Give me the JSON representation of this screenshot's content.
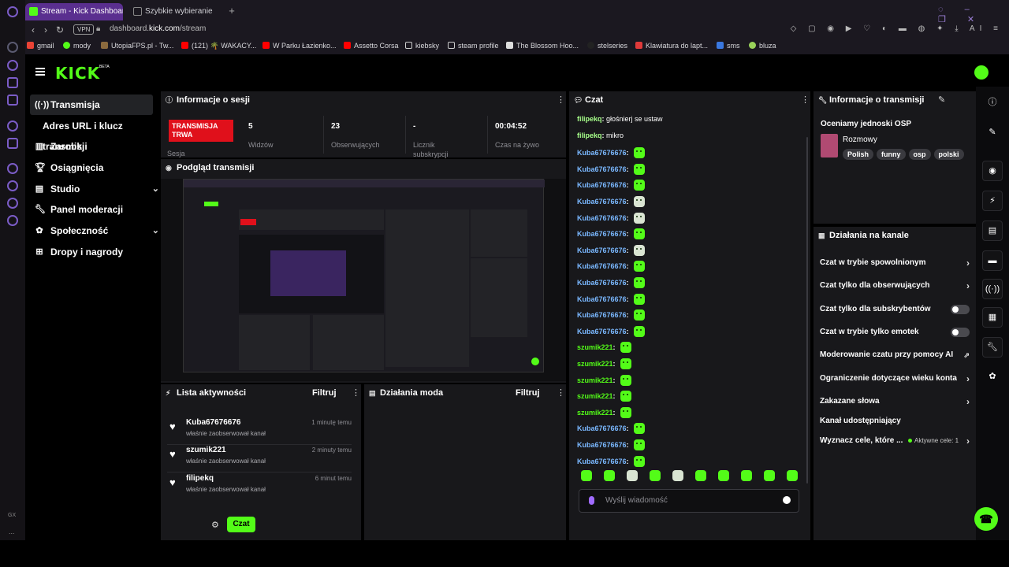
{
  "browser": {
    "tabs": [
      {
        "label": "Stream - Kick Dashboard"
      },
      {
        "label": "Szybkie wybieranie"
      }
    ],
    "url_prefix": "dashboard.",
    "url_domain": "kick.com",
    "url_path": "/stream",
    "vpn": "VPN",
    "ai": "AI",
    "bookmarks": [
      "gmail",
      "mody",
      "UtopiaFPS.pl - Tw...",
      "(121) 🌴 WAKACY...",
      "W Parku Łazienko...",
      "Assetto Corsa",
      "kiebsky",
      "steam profile",
      "The Blossom Hoo...",
      "stelseries",
      "Klawiatura do lapt...",
      "sms",
      "bluza"
    ],
    "sidebar_bottom": [
      "GX",
      "..."
    ]
  },
  "app": {
    "logo": "KICK",
    "logo_beta": "BETA",
    "nav": [
      {
        "label": "Transmisja"
      },
      {
        "label": "Adres URL i klucz transmisji"
      },
      {
        "label": "Zarobki"
      },
      {
        "label": "Osiągnięcia"
      },
      {
        "label": "Studio"
      },
      {
        "label": "Panel moderacji"
      },
      {
        "label": "Społeczność"
      },
      {
        "label": "Dropy i nagrody"
      }
    ]
  },
  "session": {
    "title": "Informacje o sesji",
    "live_badge": "TRANSMISJA TRWA",
    "sesja_label": "Sesja",
    "stats": [
      {
        "value": "5",
        "label": "Widzów"
      },
      {
        "value": "23",
        "label": "Obserwujących"
      },
      {
        "value": "-",
        "label": "Licznik subskrypcji"
      },
      {
        "value": "00:04:52",
        "label": "Czas na żywo"
      }
    ]
  },
  "preview": {
    "title": "Podgląd transmisji"
  },
  "activity": {
    "title": "Lista aktywności",
    "filter": "Filtruj",
    "items": [
      {
        "name": "Kuba67676676",
        "desc": "właśnie zaobserwował kanał",
        "time": "1 minutę temu"
      },
      {
        "name": "szumik221",
        "desc": "właśnie zaobserwował kanał",
        "time": "2 minuty temu"
      },
      {
        "name": "filipekq",
        "desc": "właśnie zaobserwował kanał",
        "time": "6 minut temu"
      }
    ]
  },
  "mod_actions": {
    "title": "Działania moda",
    "filter": "Filtruj"
  },
  "chat": {
    "title": "Czat",
    "messages": [
      {
        "user": "filipekq",
        "text": "głośnierj se ustaw",
        "color": "#a7ff8a"
      },
      {
        "user": "filipekq",
        "text": "mikro",
        "color": "#a7ff8a"
      },
      {
        "user": "Kuba67676676",
        "text": "",
        "color": "#7ab8ff"
      },
      {
        "user": "Kuba67676676",
        "text": "",
        "color": "#7ab8ff"
      },
      {
        "user": "Kuba67676676",
        "text": "",
        "color": "#7ab8ff"
      },
      {
        "user": "Kuba67676676",
        "text": "",
        "color": "#7ab8ff"
      },
      {
        "user": "Kuba67676676",
        "text": "",
        "color": "#7ab8ff"
      },
      {
        "user": "Kuba67676676",
        "text": "",
        "color": "#7ab8ff"
      },
      {
        "user": "Kuba67676676",
        "text": "",
        "color": "#7ab8ff"
      },
      {
        "user": "Kuba67676676",
        "text": "",
        "color": "#7ab8ff"
      },
      {
        "user": "Kuba67676676",
        "text": "",
        "color": "#7ab8ff"
      },
      {
        "user": "Kuba67676676",
        "text": "",
        "color": "#7ab8ff"
      },
      {
        "user": "Kuba67676676",
        "text": "",
        "color": "#7ab8ff"
      },
      {
        "user": "Kuba67676676",
        "text": "",
        "color": "#7ab8ff"
      },
      {
        "user": "szumik221",
        "text": "",
        "color": "#53fc18"
      },
      {
        "user": "szumik221",
        "text": "",
        "color": "#53fc18"
      },
      {
        "user": "szumik221",
        "text": "",
        "color": "#53fc18"
      },
      {
        "user": "szumik221",
        "text": "",
        "color": "#53fc18"
      },
      {
        "user": "szumik221",
        "text": "",
        "color": "#53fc18"
      },
      {
        "user": "Kuba67676676",
        "text": "",
        "color": "#7ab8ff"
      },
      {
        "user": "Kuba67676676",
        "text": "",
        "color": "#7ab8ff"
      },
      {
        "user": "Kuba67676676",
        "text": "",
        "color": "#7ab8ff"
      }
    ],
    "placeholder": "Wyślij wiadomość",
    "send": "Czat"
  },
  "stream_info": {
    "title": "Informacje o transmisji",
    "stream_title": "Oceniamy jednoski OSP",
    "category": "Rozmowy",
    "tags": [
      "Polish",
      "funny",
      "osp",
      "polski"
    ]
  },
  "channel_actions": {
    "title": "Działania na kanale",
    "rows": [
      {
        "label": "Czat w trybie spowolnionym",
        "kind": "arrow"
      },
      {
        "label": "Czat tylko dla obserwujących",
        "kind": "arrow"
      },
      {
        "label": "Czat tylko dla subskrybentów",
        "kind": "toggle"
      },
      {
        "label": "Czat w trybie tylko emotek",
        "kind": "toggle"
      },
      {
        "label": "Moderowanie czatu przy pomocy AI",
        "kind": "external"
      },
      {
        "label": "Ograniczenie dotyczące wieku konta",
        "kind": "arrow"
      },
      {
        "label": "Zakazane słowa",
        "kind": "arrow"
      },
      {
        "label": "Kanał udostępniający",
        "kind": "none"
      },
      {
        "label": "Wyznacz cele, które ...",
        "kind": "arrow"
      }
    ],
    "goals_active": "Aktywne cele: 1"
  },
  "colors": {
    "accent": "#53fc18",
    "live": "#e0101b",
    "panel": "#18181b"
  }
}
